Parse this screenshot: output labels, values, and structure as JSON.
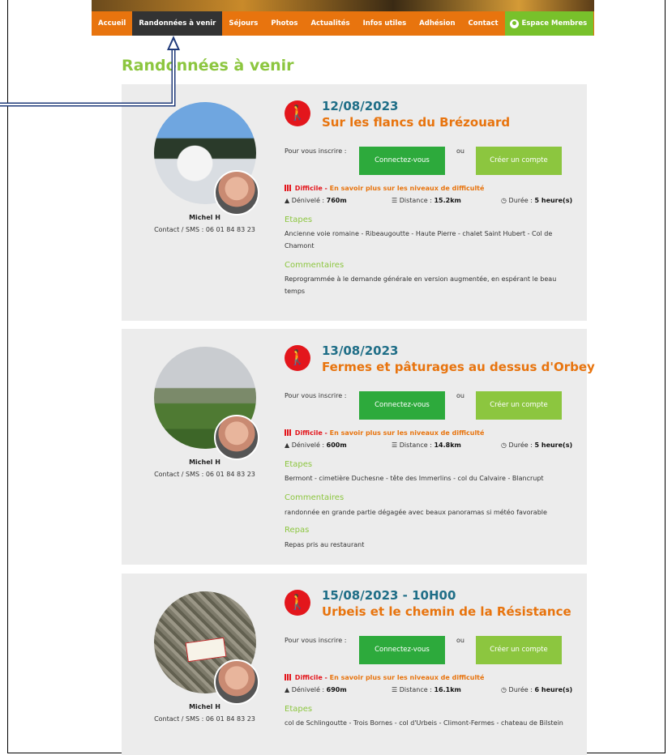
{
  "nav": {
    "items": [
      "Accueil",
      "Randonnées à venir",
      "Séjours",
      "Photos",
      "Actualités",
      "Infos utiles",
      "Adhésion",
      "Contact"
    ],
    "active": "Randonnées à venir",
    "members_label": "Espace Membres"
  },
  "page": {
    "title": "Randonnées à venir"
  },
  "common": {
    "inscribe_label": "Pour vous inscrire :",
    "connect_label": "Connectez-vous",
    "or_label": "ou",
    "create_label": "Créer un compte",
    "difficulty_prefix": "Difficile - ",
    "difficulty_link": "En savoir plus sur les niveaux de difficulté",
    "denivele_label": "Dénivelé :",
    "distance_label": "Distance :",
    "duree_label": "Durée :",
    "etapes_label": "Etapes",
    "commentaires_label": "Commentaires",
    "repas_label": "Repas"
  },
  "hikes": [
    {
      "date": "12/08/2023",
      "title": "Sur les flancs du Brézouard",
      "guide_name": "Michel H",
      "guide_contact": "Contact / SMS : 06 01 84 83 23",
      "denivele": "760m",
      "distance": "15.2km",
      "duree": "5 heure(s)",
      "etapes": "Ancienne voie romaine - Ribeaugoutte - Haute Pierre - chalet Saint Hubert - Col de Chamont",
      "commentaires": "Reprogrammée à le demande générale en version augmentée, en espérant le beau temps"
    },
    {
      "date": "13/08/2023",
      "title": "Fermes et pâturages au dessus d'Orbey",
      "guide_name": "Michel H",
      "guide_contact": "Contact / SMS : 06 01 84 83 23",
      "denivele": "600m",
      "distance": "14.8km",
      "duree": "5 heure(s)",
      "etapes": "Bermont - cimetière Duchesne - tête des Immerlins - col du Calvaire - Blancrupt",
      "commentaires": "randonnée en grande partie dégagée avec beaux panoramas si météo favorable",
      "repas": "Repas pris au restaurant"
    },
    {
      "date": "15/08/2023 - 10H00",
      "title": "Urbeis et le chemin de la Résistance",
      "guide_name": "Michel H",
      "guide_contact": "Contact / SMS : 06 01 84 83 23",
      "denivele": "690m",
      "distance": "16.1km",
      "duree": "6 heure(s)",
      "etapes": "col de Schlingoutte - Trois Bornes - col d'Urbeis - Climont-Fermes - chateau de Bilstein"
    }
  ]
}
